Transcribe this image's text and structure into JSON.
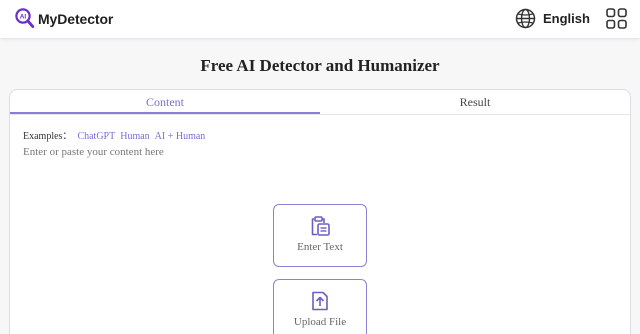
{
  "header": {
    "brand": "MyDetector",
    "logo_badge": "AI",
    "language": "English",
    "icons": {
      "language": "globe-icon",
      "menu": "apps-grid-icon"
    }
  },
  "page": {
    "title": "Free AI Detector and Humanizer"
  },
  "tabs": [
    {
      "label": "Content",
      "active": true
    },
    {
      "label": "Result",
      "active": false
    }
  ],
  "examples": {
    "label": "Examples：",
    "items": [
      "ChatGPT",
      "Human",
      "AI + Human"
    ]
  },
  "editor": {
    "placeholder": "Enter or paste your content here",
    "value": ""
  },
  "actions": {
    "enter_text": "Enter Text",
    "upload_file": "Upload File"
  },
  "colors": {
    "accent": "#7b6fd0",
    "border": "#8b82d6",
    "brand": "#6a2fc9"
  }
}
